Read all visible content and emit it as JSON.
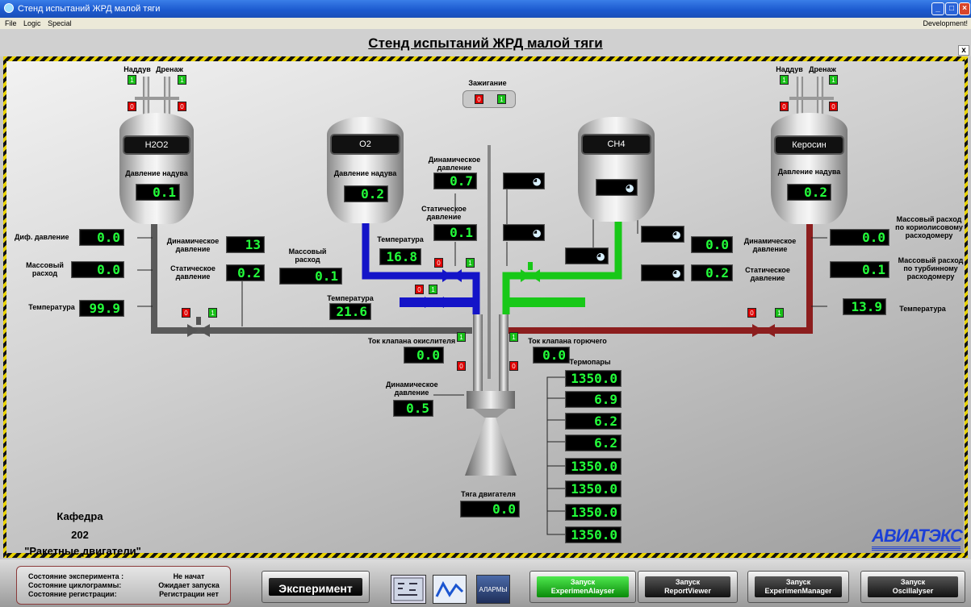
{
  "window": {
    "title": "Стенд испытаний ЖРД малой тяги",
    "menu": [
      "File",
      "Logic",
      "Special"
    ],
    "menu_right": "Development!",
    "close": "x"
  },
  "main_title": "Стенд испытаний ЖРД малой тяги",
  "ignition": {
    "label": "Зажигание",
    "off": "0",
    "on": "1"
  },
  "tanks": {
    "h2o2": {
      "name": "H2O2",
      "pressure_label": "Давление надува",
      "pressure": "0.1",
      "vent": "Наддув",
      "drain": "Дренаж"
    },
    "o2": {
      "name": "O2",
      "pressure_label": "Давление надува",
      "pressure": "0.2"
    },
    "ch4": {
      "name": "CH4"
    },
    "kero": {
      "name": "Керосин",
      "pressure_label": "Давление надува",
      "pressure": "0.2",
      "vent": "Наддув",
      "drain": "Дренаж"
    }
  },
  "left": {
    "dp_label": "Диф. давление",
    "dp": "0.0",
    "flow_label": "Массовый расход",
    "flow": "0.0",
    "temp_label": "Температура",
    "temp": "99.9",
    "dyn_label": "Динамическое давление",
    "dyn": "13",
    "stat_label": "Статическое давление",
    "stat": "0.2"
  },
  "o2line": {
    "flow_label": "Массовый расход",
    "flow": "0.1",
    "temp_label": "Температура",
    "temp": "16.8",
    "temp2_label": "Температура",
    "temp2": "21.6"
  },
  "center": {
    "dyn_label": "Динамическое давление",
    "dyn": "0.7",
    "stat_label": "Статическое давление",
    "stat": "0.1",
    "ox_valve_label": "Ток клапана окислителя",
    "ox_valve": "0.0",
    "fuel_valve_label": "Ток клапана горючего",
    "fuel_valve": "0.0",
    "chamber_label": "Динамическое давление",
    "chamber": "0.5",
    "thrust_label": "Тяга двигателя",
    "thrust": "0.0"
  },
  "right": {
    "dyn_label": "Динамическое давление",
    "dyn": "0.0",
    "stat_label": "Статическое давление",
    "stat": "0.2",
    "flow1_label": "Массовый расход по кориолисовому расходомеру",
    "flow1": "0.0",
    "flow2_label": "Массовый расход по турбинному расходомеру",
    "flow2": "0.1",
    "temp_label": "Температура",
    "temp": "13.9"
  },
  "thermo": {
    "label": "Термопары",
    "values": [
      "1350.0",
      "6.9",
      "6.2",
      "6.2",
      "1350.0",
      "1350.0",
      "1350.0",
      "1350.0"
    ]
  },
  "dept": {
    "line1": "Кафедра",
    "line2": "202",
    "line3": "\"Ракетные двигатели\""
  },
  "logo": "АВИАТЭКС",
  "status": {
    "rows": [
      {
        "k": "Состояние эксперимента :",
        "v": "Не начат"
      },
      {
        "k": "Состояние циклограммы:",
        "v": "Ожидает запуска"
      },
      {
        "k": "Состояние регистрации:",
        "v": "Регистрации нет"
      }
    ]
  },
  "buttons": {
    "experiment": "Эксперимент",
    "alarms": "АЛАРМЫ",
    "b1": [
      "Запуск",
      "ExperimenAlayser"
    ],
    "b2": [
      "Запуск",
      "ReportViewer"
    ],
    "b3": [
      "Запуск",
      "ExperimenManager"
    ],
    "b4": [
      "Запуск",
      "Oscillalyser"
    ]
  },
  "colors": {
    "oxidizer": "#1414c8",
    "methane": "#18c818",
    "kerosene": "#8c1e1e",
    "h2o2": "#606060",
    "display": "#23ff3a"
  }
}
